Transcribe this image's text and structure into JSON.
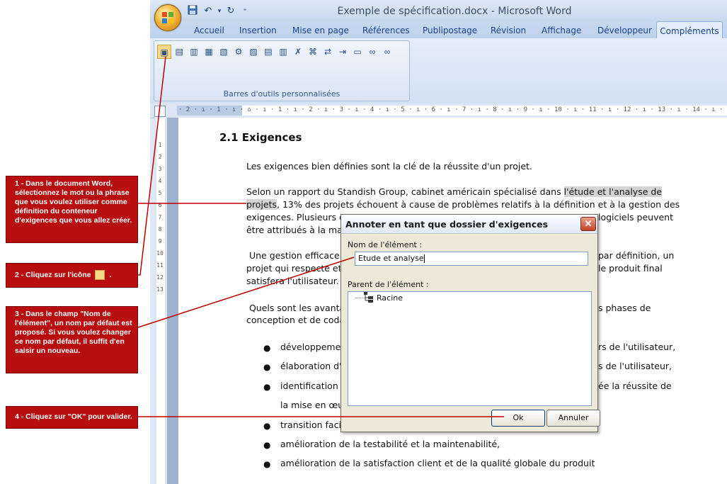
{
  "window": {
    "title": "Exemple de spécification.docx - Microsoft Word"
  },
  "ribbon": {
    "tabs": [
      "Accueil",
      "Insertion",
      "Mise en page",
      "Références",
      "Publipostage",
      "Révision",
      "Affichage",
      "Développeur"
    ],
    "active_tab": "Compléments",
    "group_label": "Barres d'outils personnalisées",
    "tool_icons": [
      "folder-tree-icon",
      "folder-icon",
      "folder-icon",
      "folder-icon",
      "folder-icon",
      "gear-icon",
      "folder-icon",
      "folder-icon",
      "folder-icon",
      "delete-link-icon",
      "xml-icon",
      "xml-icon",
      "xml-icon",
      "folder-icon",
      "link-icon",
      "link-icon"
    ]
  },
  "ruler": {
    "horizontal": "· 2 · ı · 1 · ı · ⌂ · ı · 1 · ı · 2 · ı · 3 · ı · 4 · ı · 5 · ı · 6 · ı · 7 · ı · 8 · ı · 9 · ı · 10 · ı · 11 · ı · 12 · ı · 13 · ı · 14 · ı · 15 · ı · 16 · ı · 17 · ı",
    "vertical": [
      "1",
      "2",
      "3",
      "4",
      "5",
      "6",
      "7",
      "8",
      "9",
      "10",
      "11",
      "12",
      "13"
    ]
  },
  "document": {
    "heading": "2.1 Exigences",
    "p1": "Les exigences bien définies sont la clé de la réussite d'un projet.",
    "p2a": "Selon un rapport du Standish Group, cabinet américain spécialisé dans ",
    "p2_highlight": "l'étude et l'analyse de",
    "p2_highlight2": "projets",
    "p2b": ", 13% des projets échouent à cause de problèmes relatifs à la définition et à la gestion des",
    "p2c": "exigences.  Plusieurs e",
    "p2c_right": "logiciels peuvent",
    "p2d": "être attribués à la mau",
    "p3a": " Une gestion efficace d",
    "p3a_right": "par définition, un",
    "p3b": "projet qui respecte et",
    "p3b_right": "le produit final",
    "p3c": "satisfera l'utilisateur.",
    "p4a": " Quels sont les avantag",
    "p4a_right": "s phases de",
    "p4b": "conception et de coda",
    "bullets": [
      {
        "left": "développeme",
        "right": "rs de l'utilisateur,"
      },
      {
        "left": "élaboration d'",
        "right": "s de l'utilisateur,"
      },
      {
        "left": "identification d",
        "right": "ée la réussite de"
      },
      {
        "left": "la mise en œuv",
        "right": ""
      },
      {
        "left": "transition facil",
        "right": ""
      },
      {
        "left": "amélioration de la testabilité et la maintenabilité,",
        "right": ""
      },
      {
        "left": "amélioration de la satisfaction client et de la qualité globale du produit",
        "right": ""
      }
    ]
  },
  "dialog": {
    "title": "Annoter en tant que dossier d'exigences",
    "close": "✕",
    "name_label": "Nom de l'élément :",
    "name_value": "Etude et analyse",
    "parent_label": "Parent de l'élément :",
    "tree_root": "Racine",
    "ok": "Ok",
    "cancel": "Annuler"
  },
  "callouts": {
    "c1": "1 - Dans le document Word, sélectionnez le mot ou la phrase que vous voulez utiliser comme définition du conteneur d'exigences que vous allez créer.",
    "c2": "2 - Cliquez sur l'icône",
    "c2_end": ".",
    "c3": "3 - Dans le champ \"Nom de l'élément\", un nom par défaut est proposé. Si vous voulez changer ce nom par défaut, il suffit d'en saisir un nouveau.",
    "c4": "4 - Cliquez sur \"OK\" pour valider."
  },
  "colors": {
    "callout": "#b70f0f",
    "annotation_line": "#c00000",
    "ribbon": "#dfe8f5"
  }
}
